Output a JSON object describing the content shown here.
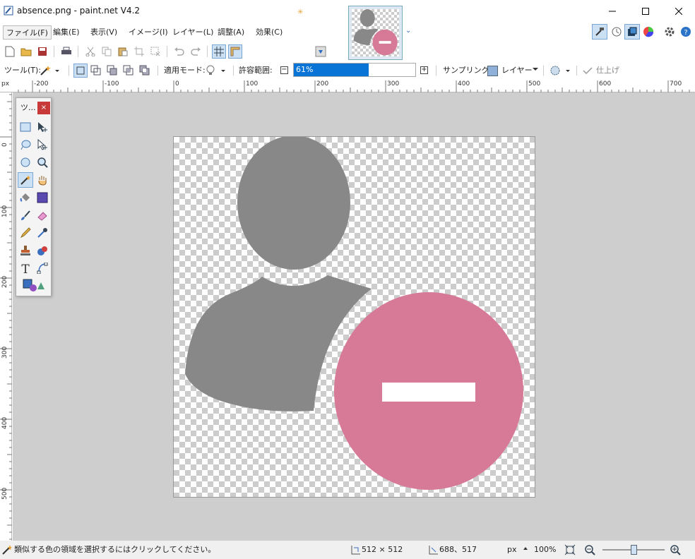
{
  "window": {
    "title": "absence.png - paint.net V4.2"
  },
  "menu": [
    "ファイル(F)",
    "編集(E)",
    "表示(V)",
    "イメージ(I)",
    "レイヤー(L)",
    "調整(A)",
    "効果(C)"
  ],
  "toolbar2": {
    "tool_label": "ツール(T):",
    "blend_label": "適用モード:",
    "tolerance_label": "許容範囲:",
    "tolerance_value": "61%",
    "tolerance_fraction": 0.61,
    "sampling_label": "サンプリング:",
    "sampling_value": "レイヤー",
    "finish_label": "仕上げ"
  },
  "ruler_top": [
    "-200",
    "-100",
    "0",
    "100",
    "200",
    "300",
    "400",
    "500",
    "600",
    "700"
  ],
  "ruler_left": [
    "0",
    "100",
    "200",
    "300",
    "400",
    "500"
  ],
  "ruler_unit": "px",
  "tools_window": {
    "title": "ツ..."
  },
  "status": {
    "hint": "類似する色の領域を選択するにはクリックしてください。",
    "image_size": "512 × 512",
    "cursor_pos": "688、517",
    "unit": "px",
    "zoom": "100%"
  },
  "colors": {
    "person": "#888888",
    "badge": "#d77a98",
    "accent": "#0a74d6"
  }
}
